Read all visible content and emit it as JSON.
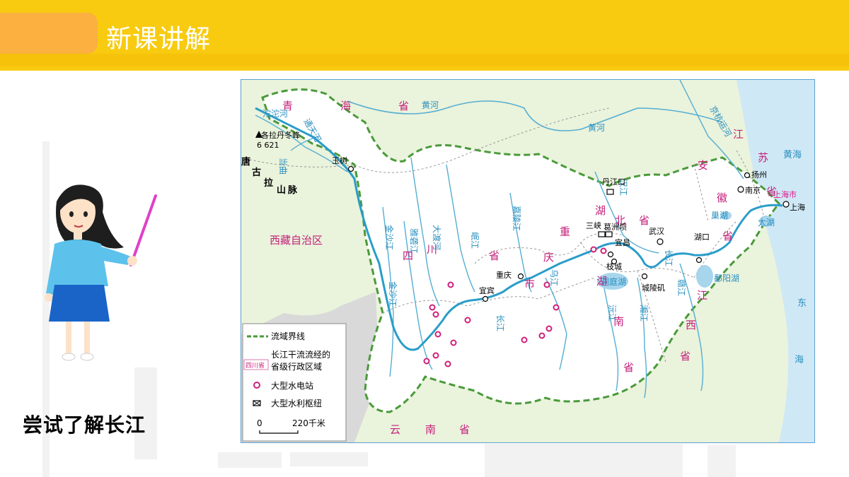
{
  "header": {
    "title": "新课讲解"
  },
  "subtitle": "尝试了解长江",
  "map": {
    "provinces": [
      "青",
      "海",
      "省",
      "西藏自治区",
      "四",
      "川",
      "省",
      "重",
      "庆",
      "市",
      "湖",
      "北",
      "省",
      "湖",
      "南",
      "省",
      "江",
      "西",
      "省",
      "安",
      "徽",
      "省",
      "江",
      "苏",
      "省",
      "云",
      "南",
      "省",
      "上海市"
    ],
    "rivers": [
      "沱沱河",
      "通天河",
      "当曲",
      "金沙江",
      "雅砻江",
      "大渡河",
      "岷江",
      "嘉陵江",
      "汉江",
      "乌江",
      "沅江",
      "湘江",
      "赣江",
      "长江",
      "黄河",
      "京杭运河",
      "黄河",
      "洞庭湖",
      "鄱阳湖",
      "巢湖",
      "太湖",
      "长江",
      "金沙江"
    ],
    "mountains": [
      "唐",
      "古",
      "拉",
      "山",
      "脉"
    ],
    "peak": "各拉丹冬峰",
    "peak_elevation": "6 621",
    "cities": [
      "玉树",
      "宜宾",
      "重庆",
      "三峡",
      "葛洲坝",
      "宜昌",
      "枝城",
      "武汉",
      "城陵矶",
      "湖口",
      "丹江口",
      "南京",
      "扬州",
      "上海"
    ],
    "seas": [
      "黄海",
      "东",
      "海"
    ],
    "legend": {
      "boundary": "流域界线",
      "province_sample": "四川省",
      "province_desc_1": "长江干流流经的",
      "province_desc_2": "省级行政区域",
      "hydro": "大型水电站",
      "hub": "大型水利枢纽",
      "scale_zero": "0",
      "scale_label": "220千米"
    }
  }
}
